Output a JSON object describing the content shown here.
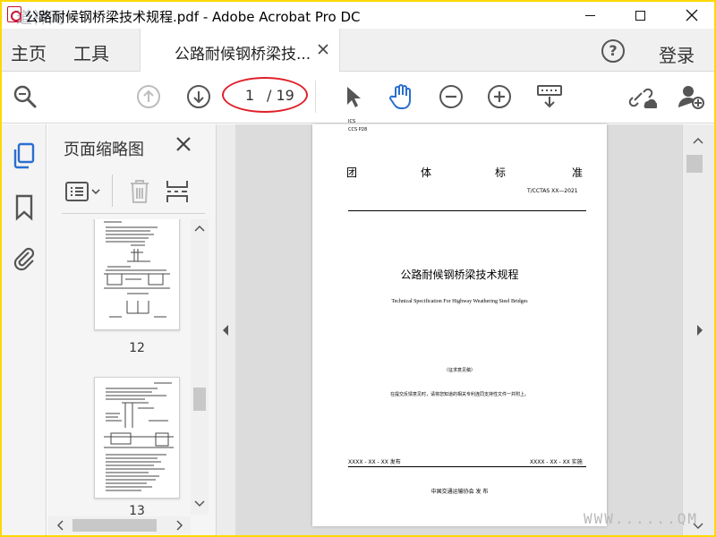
{
  "window": {
    "title": "公路耐候钢桥梁技术规程.pdf - Adobe Acrobat Pro DC",
    "watermark": "道神网"
  },
  "tabs": {
    "home": "主页",
    "tools": "工具",
    "doc": "公路耐候钢桥梁技...",
    "login": "登录"
  },
  "toolbar": {
    "current_page": "1",
    "total_pages": "/ 19"
  },
  "thumbnails": {
    "title": "页面缩略图",
    "pages": [
      {
        "label": "12"
      },
      {
        "label": "13"
      }
    ]
  },
  "page": {
    "code_line1": "ICS",
    "code_line2": "CCS  P28",
    "std_type": [
      "团",
      "体",
      "标",
      "准"
    ],
    "std_number": "T/CCTAS  XX—2021",
    "title_cn": "公路耐候钢桥梁技术规程",
    "title_en": "Technical Specification For Highway Weathering Steel Bridges",
    "draft_note": "（征求意见稿）",
    "notice": "在提交反馈意见时，请将您知道的相关专利连同支持性文件一并附上。",
    "issue_date": "XXXX - XX - XX 发布",
    "impl_date": "XXXX - XX - XX 实施",
    "publisher": "中国交通运输协会    发  布"
  },
  "corner_watermark": "WWW......QM",
  "colors": {
    "accent_blue": "#2a6fcf",
    "highlight_red": "#e0202a",
    "frame_yellow": "#ffd800"
  }
}
